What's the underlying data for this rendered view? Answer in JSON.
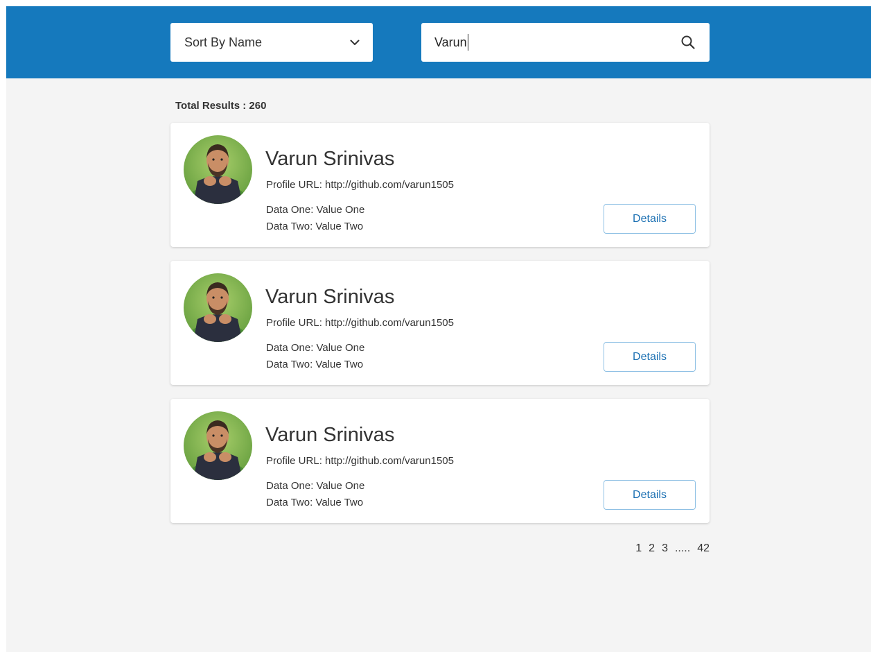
{
  "header": {
    "sort": {
      "selected": "Sort By Name",
      "icon": "chevron-down-icon"
    },
    "search": {
      "value": "Varun",
      "icon": "search-icon"
    },
    "colors": {
      "bar": "#1579bd"
    }
  },
  "results": {
    "total_label": "Total Results : 260",
    "cards": [
      {
        "name": "Varun Srinivas",
        "profile_url": "Profile URL: http://github.com/varun1505",
        "data_one": "Data One: Value One",
        "data_two": "Data Two: Value Two",
        "button": "Details"
      },
      {
        "name": "Varun Srinivas",
        "profile_url": "Profile URL: http://github.com/varun1505",
        "data_one": "Data One: Value One",
        "data_two": "Data Two: Value Two",
        "button": "Details"
      },
      {
        "name": "Varun Srinivas",
        "profile_url": "Profile URL: http://github.com/varun1505",
        "data_one": "Data One: Value One",
        "data_two": "Data Two: Value Two",
        "button": "Details"
      }
    ]
  },
  "pagination": {
    "pages": [
      "1",
      "2",
      "3"
    ],
    "ellipsis": ".....",
    "last": "42"
  }
}
